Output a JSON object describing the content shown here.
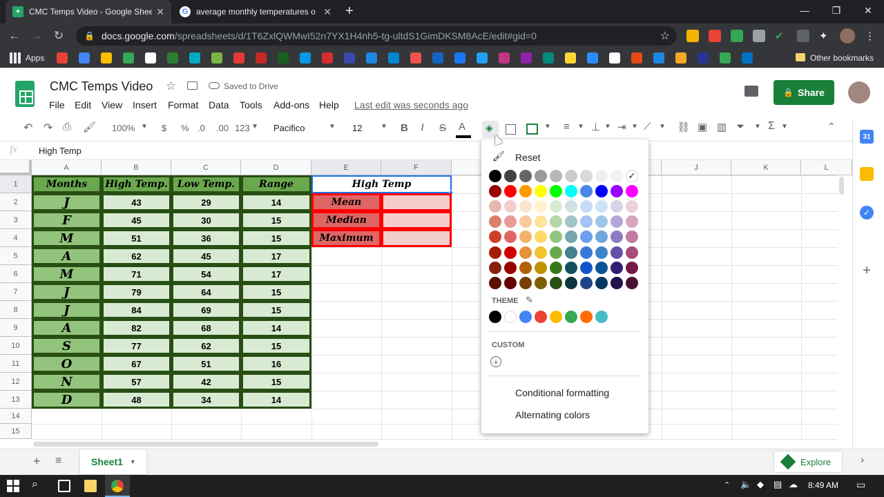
{
  "browser": {
    "tabs": [
      {
        "title": "CMC Temps Video - Google Shee",
        "active": true
      },
      {
        "title": "average monthly temperatures o",
        "active": false
      }
    ],
    "url_host": "docs.google.com",
    "url_path": "/spreadsheets/d/1T6ZxlQWMwI52n7YX1H4nh5-tg-ultdS1GimDKSM8AcE/edit#gid=0",
    "bookmarks_apps": "Apps",
    "bookmarks_other": "Other bookmarks"
  },
  "sheets": {
    "doc_title": "CMC Temps Video",
    "saved_status": "Saved to Drive",
    "menu": [
      "File",
      "Edit",
      "View",
      "Insert",
      "Format",
      "Data",
      "Tools",
      "Add-ons",
      "Help"
    ],
    "last_edit": "Last edit was seconds ago",
    "share_label": "Share",
    "toolbar": {
      "zoom": "100%",
      "currency": "$",
      "percent": "%",
      "dec_dec": ".0",
      "dec_inc": ".00",
      "more_formats": "123",
      "font": "Pacifico",
      "font_size": "12",
      "bold": "B",
      "italic": "I",
      "strike": "S",
      "text_color": "A"
    },
    "fx_label": "fx",
    "formula_value": "High Temp",
    "columns": [
      "A",
      "B",
      "C",
      "D",
      "E",
      "F",
      "J",
      "K",
      "L"
    ],
    "rows": [
      "1",
      "2",
      "3",
      "4",
      "5",
      "6",
      "7",
      "8",
      "9",
      "10",
      "11",
      "12",
      "13",
      "14",
      "15"
    ],
    "table_header": [
      "Months",
      "High Temp.",
      "Low Temp.",
      "Range"
    ],
    "table_rows": [
      [
        "J",
        "43",
        "29",
        "14"
      ],
      [
        "F",
        "45",
        "30",
        "15"
      ],
      [
        "M",
        "51",
        "36",
        "15"
      ],
      [
        "A",
        "62",
        "45",
        "17"
      ],
      [
        "M",
        "71",
        "54",
        "17"
      ],
      [
        "J",
        "79",
        "64",
        "15"
      ],
      [
        "J",
        "84",
        "69",
        "15"
      ],
      [
        "A",
        "82",
        "68",
        "14"
      ],
      [
        "S",
        "77",
        "62",
        "15"
      ],
      [
        "O",
        "67",
        "51",
        "16"
      ],
      [
        "N",
        "57",
        "42",
        "15"
      ],
      [
        "D",
        "48",
        "34",
        "14"
      ]
    ],
    "stats_title": "High Temp",
    "stats_labels": [
      "Mean",
      "Median",
      "Maximum"
    ],
    "sheet_tab": "Sheet1",
    "explore_label": "Explore"
  },
  "color_popup": {
    "reset_label": "Reset",
    "theme_label": "THEME",
    "custom_label": "CUSTOM",
    "conditional_label": "Conditional formatting",
    "alternating_label": "Alternating colors",
    "grid_colors": [
      [
        "#000000",
        "#434343",
        "#666666",
        "#999999",
        "#b7b7b7",
        "#cccccc",
        "#d9d9d9",
        "#efefef",
        "#f3f3f3",
        "#ffffff"
      ],
      [
        "#980000",
        "#ff0000",
        "#ff9900",
        "#ffff00",
        "#00ff00",
        "#00ffff",
        "#4a86e8",
        "#0000ff",
        "#9900ff",
        "#ff00ff"
      ],
      [
        "#e6b8af",
        "#f4cccc",
        "#fce5cd",
        "#fff2cc",
        "#d9ead3",
        "#d0e0e3",
        "#c9daf8",
        "#cfe2f3",
        "#d9d2e9",
        "#ead1dc"
      ],
      [
        "#dd7e6b",
        "#ea9999",
        "#f9cb9c",
        "#ffe599",
        "#b6d7a8",
        "#a2c4c9",
        "#a4c2f4",
        "#9fc5e8",
        "#b4a7d6",
        "#d5a6bd"
      ],
      [
        "#cc4125",
        "#e06666",
        "#f6b26b",
        "#ffd966",
        "#93c47d",
        "#76a5af",
        "#6d9eeb",
        "#6fa8dc",
        "#8e7cc3",
        "#c27ba0"
      ],
      [
        "#a61c00",
        "#cc0000",
        "#e69138",
        "#f1c232",
        "#6aa84f",
        "#45818e",
        "#3c78d8",
        "#3d85c6",
        "#674ea7",
        "#a64d79"
      ],
      [
        "#85200c",
        "#990000",
        "#b45f06",
        "#bf9000",
        "#38761d",
        "#134f5c",
        "#1155cc",
        "#0b5394",
        "#351c75",
        "#741b47"
      ],
      [
        "#5b0f00",
        "#660000",
        "#783f04",
        "#7f6000",
        "#274e13",
        "#0c343d",
        "#1c4587",
        "#073763",
        "#20124d",
        "#4c1130"
      ]
    ],
    "theme_colors": [
      "#000000",
      "#ffffff",
      "#4285f4",
      "#ea4335",
      "#fbbc04",
      "#34a853",
      "#ff6d01",
      "#46bdc6"
    ]
  },
  "taskbar": {
    "time": "8:49 AM"
  },
  "palette": {
    "header_green": "#6aa84f",
    "cell_green": "#d9ead3",
    "month_green": "#93c47d",
    "border_green": "#274e13",
    "stats_pink": "#e06666",
    "stats_light": "#f4cccc",
    "stats_border": "#ff0000",
    "share_green": "#188038"
  }
}
